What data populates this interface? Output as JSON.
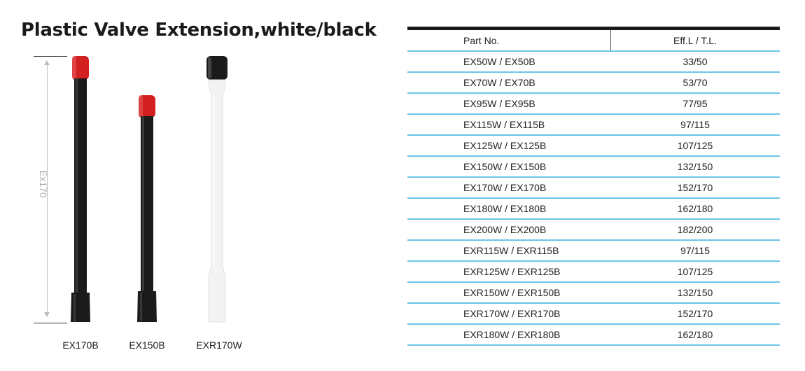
{
  "title": "Plastic Valve Extension,white/black",
  "dimension_label": "Ex170",
  "products": [
    {
      "caption": "EX170B",
      "body_color": "#1b1b1b",
      "cap_color": "#d21f1f"
    },
    {
      "caption": "EX150B",
      "body_color": "#1b1b1b",
      "cap_color": "#d21f1f"
    },
    {
      "caption": "EXR170W",
      "body_color": "#f3f3f3",
      "cap_color": "#1b1b1b"
    }
  ],
  "table": {
    "headers": {
      "part": "Part No.",
      "eff": "Eff.L / T.L."
    },
    "rows": [
      {
        "part": "EX50W / EX50B",
        "eff": "33/50"
      },
      {
        "part": "EX70W / EX70B",
        "eff": "53/70"
      },
      {
        "part": "EX95W / EX95B",
        "eff": "77/95"
      },
      {
        "part": "EX115W / EX115B",
        "eff": "97/115"
      },
      {
        "part": "EX125W / EX125B",
        "eff": "107/125"
      },
      {
        "part": "EX150W / EX150B",
        "eff": "132/150"
      },
      {
        "part": "EX170W / EX170B",
        "eff": "152/170"
      },
      {
        "part": "EX180W / EX180B",
        "eff": "162/180"
      },
      {
        "part": "EX200W / EX200B",
        "eff": "182/200"
      },
      {
        "part": "EXR115W / EXR115B",
        "eff": "97/115"
      },
      {
        "part": "EXR125W / EXR125B",
        "eff": "107/125"
      },
      {
        "part": "EXR150W / EXR150B",
        "eff": "132/150"
      },
      {
        "part": "EXR170W / EXR170B",
        "eff": "152/170"
      },
      {
        "part": "EXR180W / EXR180B",
        "eff": "162/180"
      }
    ]
  },
  "colors": {
    "rule_blue": "#6ec6e6",
    "title": "#1a1a1a"
  }
}
